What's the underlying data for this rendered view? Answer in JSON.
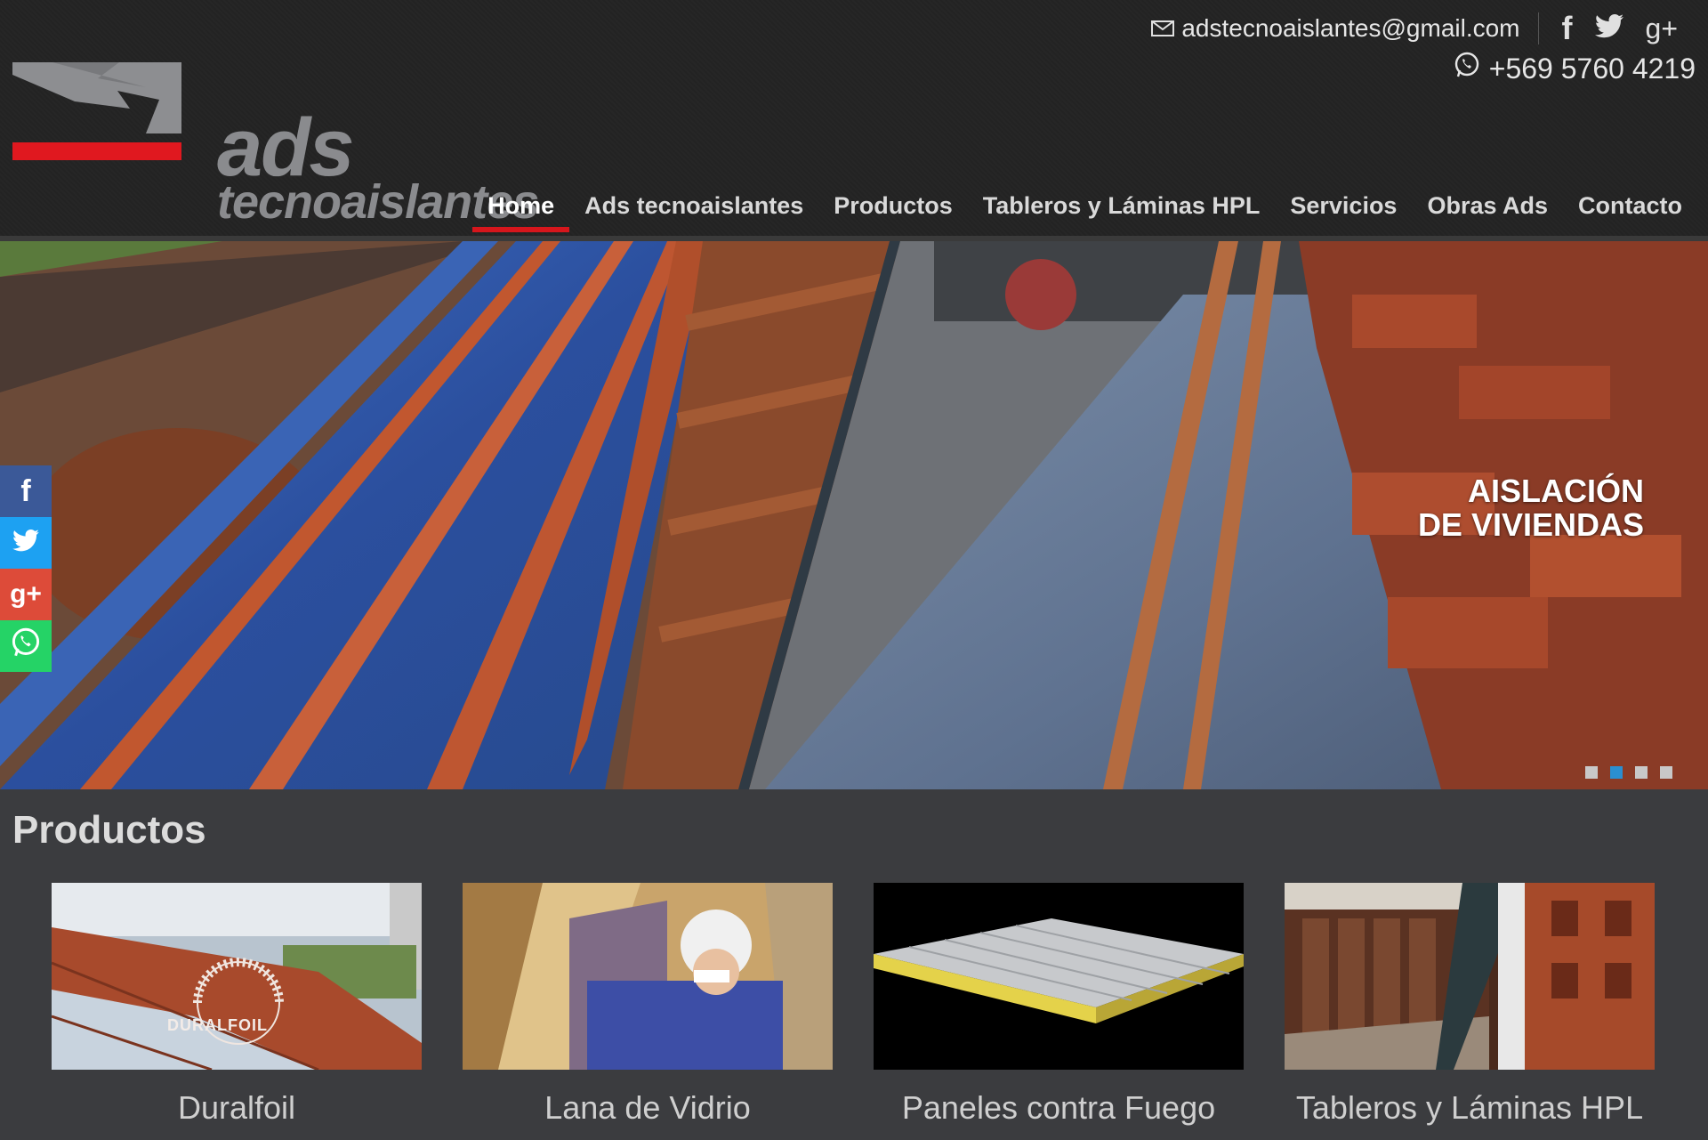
{
  "brand": {
    "name_line1": "ads",
    "name_line2": "tecnoaislantes"
  },
  "contact": {
    "email": "adstecnoaislantes@gmail.com",
    "phone": "+569 5760 4219",
    "social_top": [
      "facebook-icon",
      "twitter-icon",
      "google-plus-icon"
    ]
  },
  "nav": {
    "items": [
      {
        "label": "Home",
        "active": true
      },
      {
        "label": "Ads tecnoaislantes"
      },
      {
        "label": "Productos"
      },
      {
        "label": "Tableros y Láminas HPL"
      },
      {
        "label": "Servicios"
      },
      {
        "label": "Obras Ads"
      },
      {
        "label": "Contacto"
      }
    ]
  },
  "hero": {
    "caption_line1": "AISLACIÓN",
    "caption_line2": "DE VIVIENDAS",
    "slides": 4,
    "active_slide": 2
  },
  "share": [
    "facebook-icon",
    "twitter-icon",
    "google-plus-icon",
    "whatsapp-icon"
  ],
  "products": {
    "title": "Productos",
    "items": [
      {
        "label": "Duralfoil",
        "watermark": "DURALFOIL"
      },
      {
        "label": "Lana de Vidrio"
      },
      {
        "label": "Paneles contra Fuego"
      },
      {
        "label": "Tableros y Láminas HPL"
      }
    ]
  },
  "colors": {
    "header_bg": "#232323",
    "body_bg": "#3b3c3f",
    "accent_red": "#d6161c",
    "slider_active": "#2a8fd0"
  }
}
